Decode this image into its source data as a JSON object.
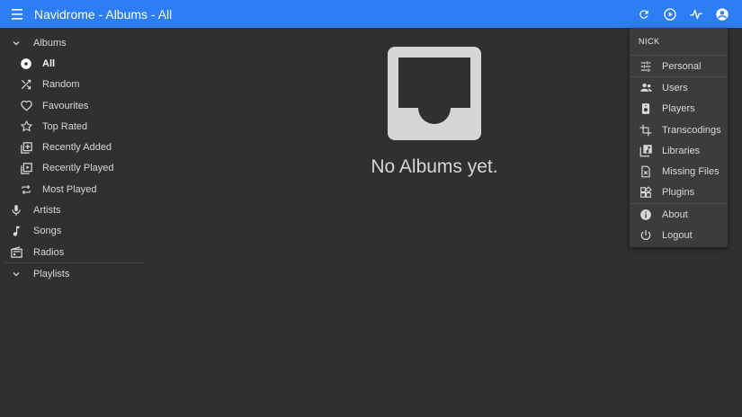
{
  "appbar": {
    "title": "Navidrome - Albums - All",
    "menu_icon": "hamburger-menu-icon",
    "actions": [
      {
        "name": "refresh-icon"
      },
      {
        "name": "play-circle-icon"
      },
      {
        "name": "activity-icon"
      },
      {
        "name": "account-circle-icon"
      }
    ]
  },
  "sidebar": {
    "albums": {
      "label": "Albums",
      "icon": "chevron-down-icon"
    },
    "album_items": [
      {
        "label": "All",
        "icon": "album-disc-icon",
        "active": true
      },
      {
        "label": "Random",
        "icon": "shuffle-icon"
      },
      {
        "label": "Favourites",
        "icon": "heart-icon"
      },
      {
        "label": "Top Rated",
        "icon": "star-icon"
      },
      {
        "label": "Recently Added",
        "icon": "library-add-icon"
      },
      {
        "label": "Recently Played",
        "icon": "video-library-icon"
      },
      {
        "label": "Most Played",
        "icon": "repeat-icon"
      }
    ],
    "artists": {
      "label": "Artists",
      "icon": "microphone-icon"
    },
    "songs": {
      "label": "Songs",
      "icon": "music-note-icon"
    },
    "radios": {
      "label": "Radios",
      "icon": "radio-icon"
    },
    "playlists": {
      "label": "Playlists",
      "icon": "chevron-down-icon"
    }
  },
  "main": {
    "empty_icon": "inbox-icon",
    "empty_text": "No Albums yet."
  },
  "user_menu": {
    "username": "NICK",
    "items": [
      {
        "label": "Personal",
        "icon": "tune-icon"
      },
      {
        "label": "Users",
        "icon": "people-icon"
      },
      {
        "label": "Players",
        "icon": "speaker-icon"
      },
      {
        "label": "Transcodings",
        "icon": "crop-icon"
      },
      {
        "label": "Libraries",
        "icon": "library-music-icon"
      },
      {
        "label": "Missing Files",
        "icon": "missing-file-icon"
      },
      {
        "label": "Plugins",
        "icon": "widgets-icon"
      },
      {
        "label": "About",
        "icon": "info-icon"
      },
      {
        "label": "Logout",
        "icon": "power-icon"
      }
    ]
  },
  "colors": {
    "appbar": "#2d7df5",
    "background": "#303030",
    "menu": "#3c3c3c"
  }
}
